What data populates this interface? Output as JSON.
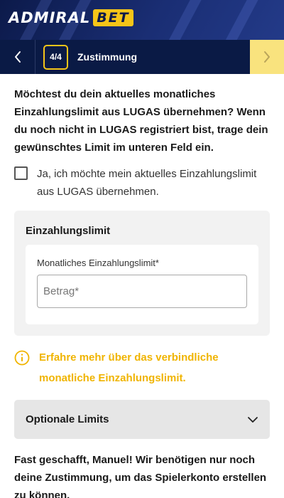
{
  "brand": {
    "logo_text": "ADMIRAL",
    "logo_badge": "BET",
    "colors": {
      "header_bg": "#1a2e74",
      "accent": "#f5c518",
      "step_bar_bg": "#0a1a45",
      "link": "#f0b400"
    }
  },
  "step_nav": {
    "back_icon": "chevron-left-icon",
    "step_indicator": "4/4",
    "title": "Zustimmung",
    "next_icon": "chevron-right-icon"
  },
  "intro_text": "Möchtest du dein aktuelles monatliches Einzahlungslimit aus LUGAS übernehmen? Wenn du noch nicht in LUGAS registriert bist, trage dein gewünschtes Limit im unteren Feld ein.",
  "consent": {
    "checked": false,
    "label": "Ja, ich möchte mein aktuelles Einzahlungslimit aus LUGAS übernehmen."
  },
  "deposit_limit": {
    "title": "Einzahlungslimit",
    "field_label": "Monatliches Einzahlungslimit*",
    "input_value": "",
    "input_placeholder": "Betrag*"
  },
  "info": {
    "icon": "info-icon",
    "link_text": "Erfahre mehr über das verbindliche monatliche Einzahlungslimit."
  },
  "optional_limits": {
    "label": "Optionale Limits",
    "icon": "chevron-down-icon"
  },
  "final_text": "Fast geschafft, Manuel! Wir benötigen nur noch deine Zustimmung, um das Spielerkonto erstellen zu können."
}
